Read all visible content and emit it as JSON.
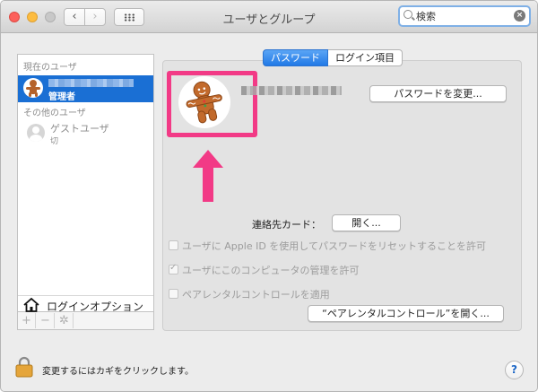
{
  "window": {
    "title": "ユーザとグループ"
  },
  "toolbar": {
    "back_glyph": "‹",
    "forward_glyph": "›"
  },
  "search": {
    "value": "検索",
    "clear_glyph": "×"
  },
  "sidebar": {
    "current_header": "現在のユーザ",
    "current_user_role": "管理者",
    "other_header": "その他のユーザ",
    "guest_name": "ゲストユーザ",
    "guest_status": "切",
    "login_options": "ログインオプション",
    "add": "+",
    "remove": "−",
    "action_glyph": "✲"
  },
  "tabs": [
    {
      "label": "パスワード"
    },
    {
      "label": "ログイン項目"
    }
  ],
  "main": {
    "change_password": "パスワードを変更...",
    "contact_card_label": "連絡先カード：",
    "open_button": "開く...",
    "checkboxes": [
      {
        "label": "ユーザに Apple ID を使用してパスワードをリセットすることを許可",
        "checked": false
      },
      {
        "label": "ユーザにこのコンピュータの管理を許可",
        "checked": true
      },
      {
        "label": "ペアレンタルコントロールを適用",
        "checked": false
      }
    ],
    "parental_button": "“ペアレンタルコントロール”を開く..."
  },
  "footer": {
    "lock_text": "変更するにはカギをクリックします。",
    "help": "?"
  },
  "colors": {
    "accent": "#1a6fd4",
    "highlight": "#f23a86"
  }
}
